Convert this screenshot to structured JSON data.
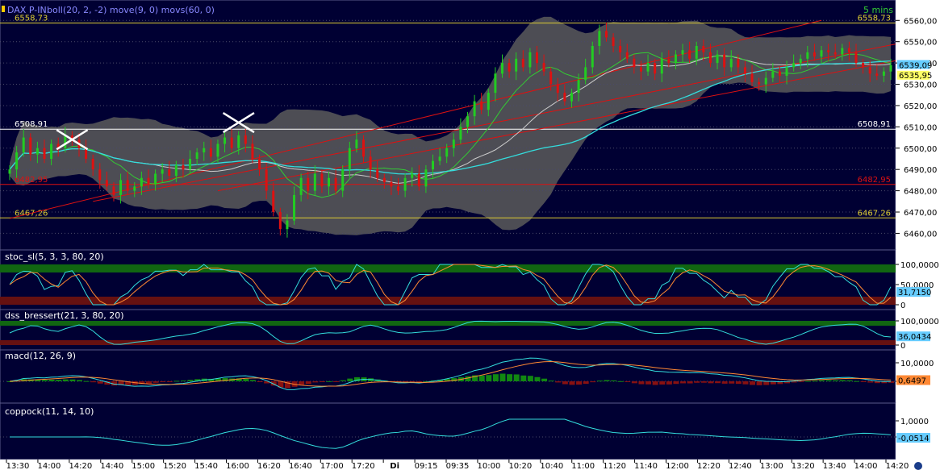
{
  "colors": {
    "panel_bg": "#000033",
    "border": "#5a5a8a",
    "axis_bg": "#ffffff",
    "grid": "#4a4a6a",
    "up": "#22cc22",
    "down": "#dd1111",
    "band_fill": "#5a5a5a",
    "ma_fast": "#33cc33",
    "ma_slow": "#cccccc",
    "ma_long": "#33dddd",
    "signal": "#ff8833",
    "channel": "#dd1111",
    "level": "#ddcc33",
    "level_hi": "#ffffff"
  },
  "chart_data": [
    {
      "type": "candlestick",
      "title": "DAX P-IN.",
      "indicators_label": "boll(20, 2, -2) move(9, 0) movs(60, 0)",
      "timeframe_label": "5 mins",
      "ylim": [
        6456,
        6562
      ],
      "y_ticks": [
        "6560,00",
        "6550,00",
        "6540,00",
        "6530,00",
        "6520,00",
        "6510,00",
        "6500,00",
        "6490,00",
        "6480,00",
        "6470,00",
        "6460,00"
      ],
      "y_tick_values": [
        6560,
        6550,
        6540,
        6530,
        6520,
        6510,
        6500,
        6490,
        6480,
        6470,
        6460
      ],
      "last_price_label": "6539,09",
      "last_price": 6539.09,
      "last_price2_label": "6535,95",
      "last_price2": 6535.95,
      "levels": [
        {
          "value": 6558.73,
          "label": "6558,73",
          "role": "resistance"
        },
        {
          "value": 6508.91,
          "label": "6508,91",
          "role": "pivot"
        },
        {
          "value": 6482.95,
          "label": "6482,95",
          "role": "support"
        },
        {
          "value": 6467.26,
          "label": "6467,26",
          "role": "support"
        }
      ],
      "channel_lines": [
        {
          "from": [
            0,
            6467
          ],
          "to": [
            117,
            6560
          ]
        },
        {
          "from": [
            12,
            6475
          ],
          "to": [
            142,
            6558
          ]
        },
        {
          "from": [
            30,
            6480
          ],
          "to": [
            142,
            6550
          ]
        }
      ],
      "marks": [
        {
          "index": 9,
          "value": 6504,
          "shape": "x"
        },
        {
          "index": 33,
          "value": 6512,
          "shape": "x"
        }
      ],
      "series_close": [
        6490,
        6498,
        6505,
        6497,
        6500,
        6495,
        6502,
        6500,
        6506,
        6504,
        6500,
        6495,
        6490,
        6485,
        6482,
        6478,
        6485,
        6480,
        6482,
        6486,
        6483,
        6488,
        6490,
        6487,
        6492,
        6490,
        6495,
        6498,
        6500,
        6496,
        6502,
        6505,
        6500,
        6506,
        6502,
        6495,
        6490,
        6480,
        6470,
        6462,
        6466,
        6478,
        6486,
        6480,
        6488,
        6482,
        6486,
        6480,
        6490,
        6500,
        6504,
        6496,
        6490,
        6486,
        6484,
        6482,
        6480,
        6486,
        6488,
        6482,
        6490,
        6494,
        6496,
        6500,
        6504,
        6510,
        6515,
        6522,
        6518,
        6526,
        6535,
        6540,
        6536,
        6542,
        6538,
        6545,
        6540,
        6536,
        6530,
        6526,
        6522,
        6526,
        6532,
        6538,
        6548,
        6555,
        6552,
        6548,
        6545,
        6542,
        6538,
        6536,
        6540,
        6535,
        6542,
        6540,
        6544,
        6546,
        6542,
        6548,
        6545,
        6540,
        6544,
        6538,
        6542,
        6538,
        6535,
        6531,
        6530,
        6533,
        6536,
        6534,
        6538,
        6540,
        6542,
        6545,
        6543,
        6546,
        6545,
        6544,
        6547,
        6545,
        6540,
        6538,
        6535,
        6534,
        6536,
        6539
      ],
      "panels_shared_x": [
        "13:30",
        "14:00",
        "14:20",
        "14:40",
        "15:00",
        "15:20",
        "15:40",
        "16:00",
        "16:20",
        "16:40",
        "17:00",
        "17:20",
        "Di",
        "09:15",
        "09:35",
        "10:00",
        "10:20",
        "10:40",
        "11:00",
        "11:20",
        "11:40",
        "12:00",
        "12:20",
        "12:40",
        "13:00",
        "13:20",
        "13:40",
        "14:00",
        "14:20"
      ]
    },
    {
      "type": "line",
      "title": "stoc_sl(5, 3, 3, 80, 20)",
      "ylim": [
        0,
        100
      ],
      "y_ticks": [
        "100,0000",
        "50,0000",
        "0"
      ],
      "y_tick_values": [
        100,
        50,
        0
      ],
      "zones": [
        80,
        20
      ],
      "last_value_label": "31,7150",
      "last_value": 31.715
    },
    {
      "type": "line",
      "title": "dss_bressert(21, 3, 80, 20)",
      "ylim": [
        0,
        100
      ],
      "y_ticks": [
        "100,0000",
        "0"
      ],
      "y_tick_values": [
        100,
        0
      ],
      "zones": [
        80,
        20
      ],
      "last_value_label": "36,0434",
      "last_value": 36.0434
    },
    {
      "type": "bar",
      "title": "macd(12, 26, 9)",
      "ylim": [
        -10,
        10
      ],
      "y_ticks": [
        "10,0000",
        "0"
      ],
      "y_tick_values": [
        10,
        0
      ],
      "last_value_label": "0,6497",
      "last_value": 0.6497
    },
    {
      "type": "line",
      "title": "coppock(11, 14, 10)",
      "ylim": [
        -1.2,
        1.2
      ],
      "y_ticks": [
        "1,0000",
        "0"
      ],
      "y_tick_values": [
        1,
        0
      ],
      "last_value_label": "-0,0514",
      "last_value": -0.0514
    }
  ]
}
